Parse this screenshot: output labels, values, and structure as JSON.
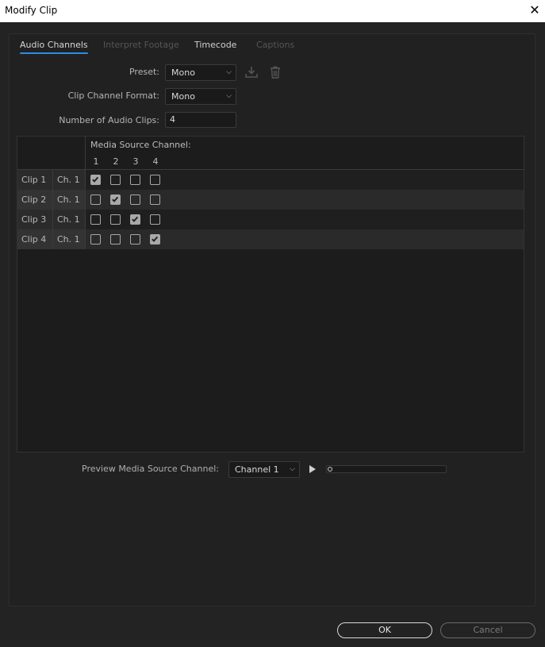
{
  "window": {
    "title": "Modify Clip"
  },
  "tabs": [
    {
      "label": "Audio Channels",
      "state": "active"
    },
    {
      "label": "Interpret Footage",
      "state": "disabled"
    },
    {
      "label": "Timecode",
      "state": "normal"
    },
    {
      "label": "Captions",
      "state": "disabled"
    }
  ],
  "form": {
    "preset_label": "Preset:",
    "preset_value": "Mono",
    "format_label": "Clip Channel Format:",
    "format_value": "Mono",
    "num_clips_label": "Number of Audio Clips:",
    "num_clips_value": "4"
  },
  "grid": {
    "header": "Media Source Channel:",
    "channels": [
      "1",
      "2",
      "3",
      "4"
    ],
    "rows": [
      {
        "clip": "Clip 1",
        "channel": "Ch. 1",
        "checks": [
          true,
          false,
          false,
          false
        ]
      },
      {
        "clip": "Clip 2",
        "channel": "Ch. 1",
        "checks": [
          false,
          true,
          false,
          false
        ]
      },
      {
        "clip": "Clip 3",
        "channel": "Ch. 1",
        "checks": [
          false,
          false,
          true,
          false
        ]
      },
      {
        "clip": "Clip 4",
        "channel": "Ch. 1",
        "checks": [
          false,
          false,
          false,
          true
        ]
      }
    ]
  },
  "preview": {
    "label": "Preview Media Source Channel:",
    "value": "Channel 1"
  },
  "buttons": {
    "ok": "OK",
    "cancel": "Cancel"
  },
  "colors": {
    "accent": "#2d8ceb",
    "background": "#232323",
    "panel": "#212121"
  },
  "icons": {
    "close": "close-icon",
    "save_preset": "save-preset-icon",
    "delete": "trash-icon",
    "play": "play-icon"
  }
}
